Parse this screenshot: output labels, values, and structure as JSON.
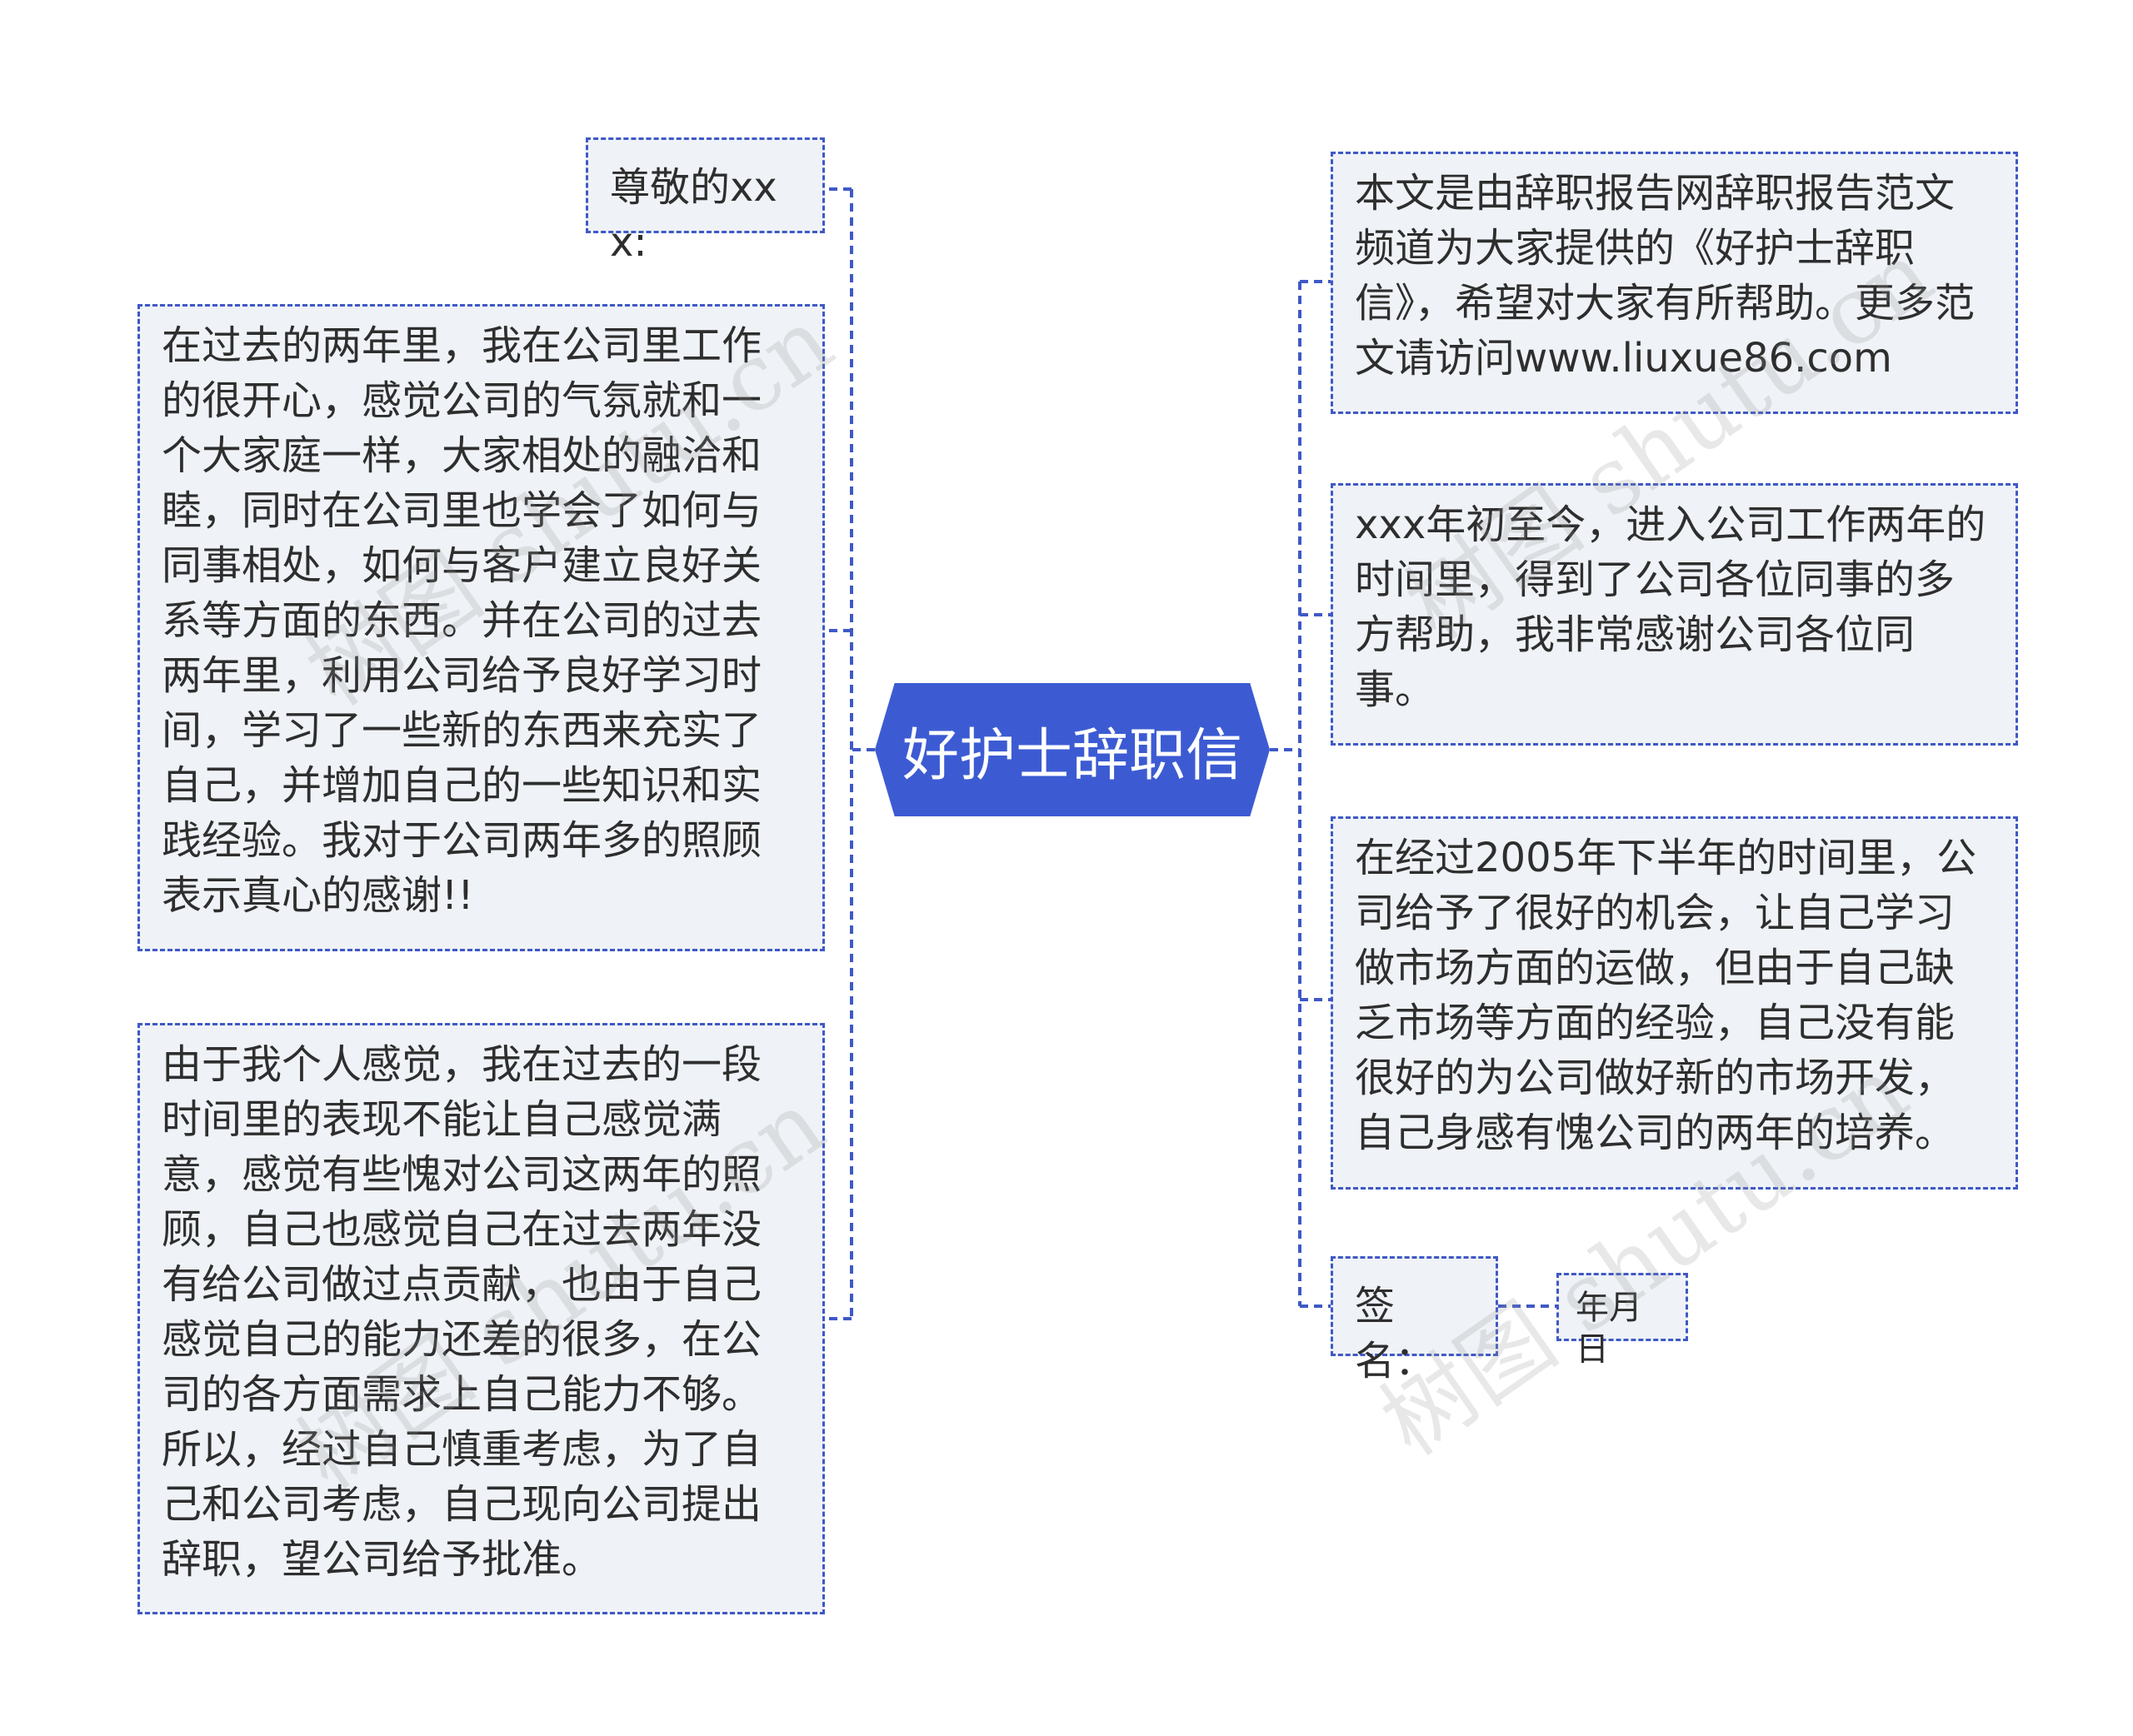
{
  "title": "好护士辞职信",
  "left_nodes": [
    {
      "text": "尊敬的xxx:"
    },
    {
      "text": "在过去的两年里，我在公司里工作的很开心，感觉公司的气氛就和一个大家庭一样，大家相处的融洽和睦，同时在公司里也学会了如何与同事相处，如何与客户建立良好关系等方面的东西。并在公司的过去两年里，利用公司给予良好学习时间，学习了一些新的东西来充实了自己，并增加自己的一些知识和实践经验。我对于公司两年多的照顾表示真心的感谢!!"
    },
    {
      "text": "由于我个人感觉，我在过去的一段时间里的表现不能让自己感觉满意，感觉有些愧对公司这两年的照顾，自己也感觉自己在过去两年没有给公司做过点贡献，也由于自己感觉自己的能力还差的很多，在公司的各方面需求上自己能力不够。所以，经过自己慎重考虑，为了自己和公司考虑，自己现向公司提出辞职，望公司给予批准。"
    }
  ],
  "right_nodes": [
    {
      "text": "本文是由辞职报告网辞职报告范文频道为大家提供的《好护士辞职信》，希望对大家有所帮助。更多范文请访问www.liuxue86.com"
    },
    {
      "text": "xxx年初至今，进入公司工作两年的时间里，得到了公司各位同事的多方帮助，我非常感谢公司各位同事。"
    },
    {
      "text": "在经过2005年下半年的时间里，公司给予了很好的机会，让自己学习做市场方面的运做，但由于自己缺乏市场等方面的经验，自己没有能很好的为公司做好新的市场开发，自己身感有愧公司的两年的培养。"
    },
    {
      "text": "签名：",
      "child": "年月日"
    }
  ],
  "watermark": "树图 shutu.cn",
  "colors": {
    "accent": "#3c5bd3",
    "border": "#3f59c6",
    "node_bg": "#eff2f6",
    "text": "#2e2e2e"
  }
}
